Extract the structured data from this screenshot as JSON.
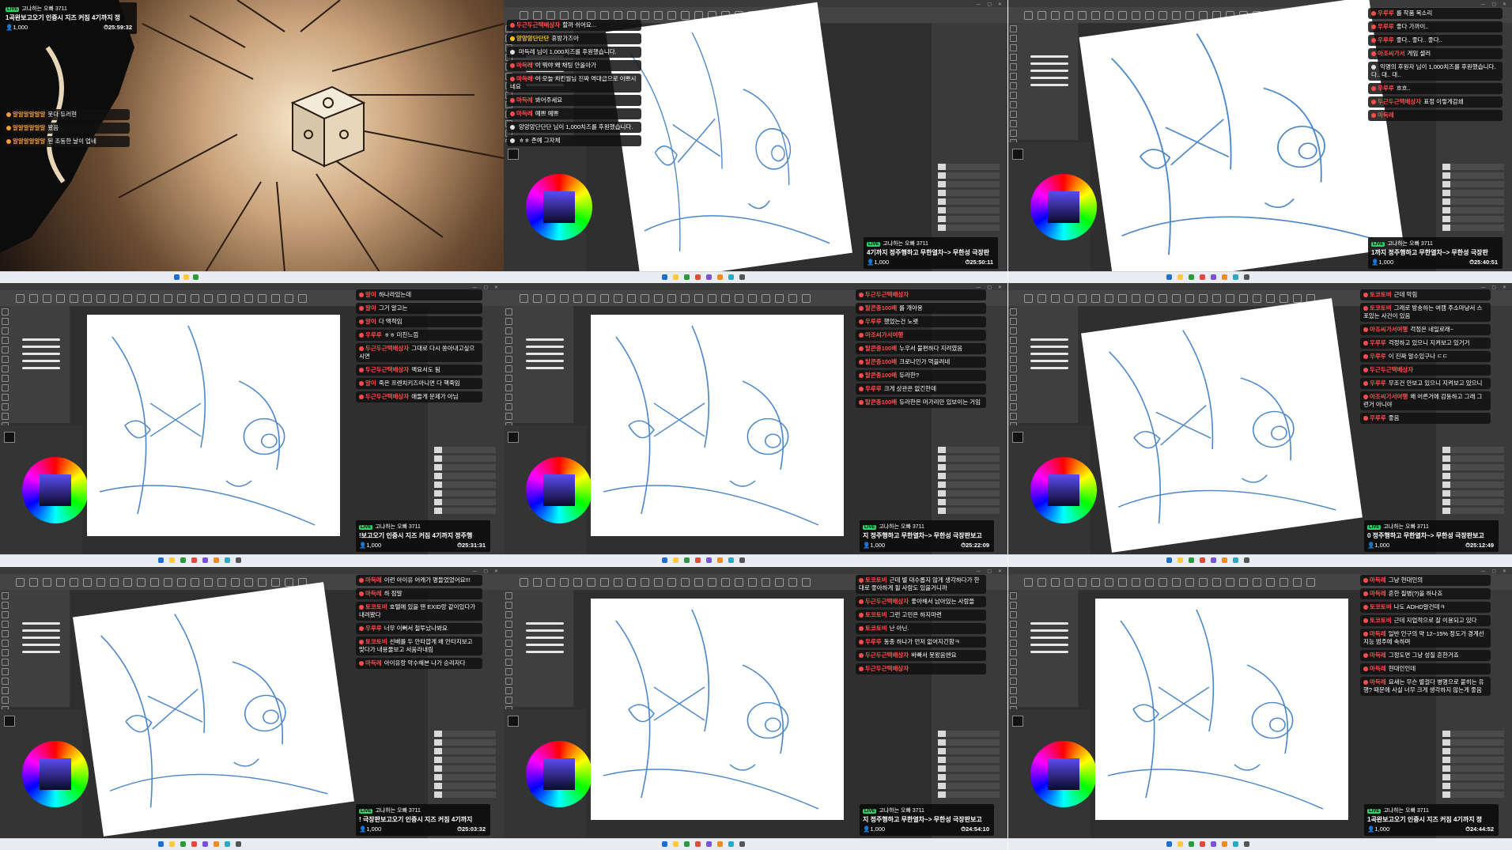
{
  "cells": [
    {
      "id": "cell-1",
      "info": {
        "live": "LIVE",
        "streamer": "고냐하는 오빠 3711",
        "ticker": "1곡완보고오기 인증시 지즈 커짐",
        "suffix": "4기까지 정",
        "viewers": "1,000",
        "timer": "25:59:32"
      },
      "chat": [
        {
          "nick": "알알알알알알",
          "text": "못다 듀러현",
          "color": "#f39a3c"
        },
        {
          "nick": "알알알알알알",
          "text": "왔음",
          "color": "#f39a3c"
        },
        {
          "nick": "알알알알알알",
          "text": "된 조동한 날이 업네",
          "color": "#f39a3c"
        }
      ]
    },
    {
      "id": "cell-2",
      "info": {
        "live": "LIVE",
        "streamer": "고냐하는 오빠 3711",
        "ticker": "4기까지 정주행하고 무한열차~> 무한성 극장판",
        "suffix": "",
        "viewers": "1,000",
        "timer": "25:50:11"
      },
      "chat": [
        {
          "nick": "두근두근택배상자",
          "text": "할까 쉬어요...",
          "color": "#ff4d4d"
        },
        {
          "nick": "앙앙앙단단단",
          "text": "휴방가즈아",
          "color": "#f0c419"
        },
        {
          "nick": "",
          "text": "마득레 님이 1,000치즈를 후원했습니다.",
          "color": "#ffffff"
        },
        {
          "nick": "마득레",
          "text": "이 뭐야 왜 채팅 안올아가",
          "color": "#ff4d4d"
        },
        {
          "nick": "마득레",
          "text": "이 오늘 치킨월님 진짜 역대급으로 이쁘시네요",
          "color": "#ff4d4d"
        },
        {
          "nick": "마득레",
          "text": "봐어주세요",
          "color": "#ff4d4d"
        },
        {
          "nick": "마득레",
          "text": "예쁘 예쁘",
          "color": "#ff4d4d"
        },
        {
          "nick": "",
          "text": "앙앙앙단단단 님이 1,000치즈를 후원했습니다.",
          "color": "#ffffff"
        },
        {
          "nick": "",
          "text": "ㅎㅎ 존예 그자체",
          "color": "#ffffff"
        }
      ]
    },
    {
      "id": "cell-3",
      "info": {
        "live": "LIVE",
        "streamer": "고냐하는 오빠 3711",
        "ticker": "1까지 정주행하고 무한열차~> 무한성 극장판",
        "suffix": "",
        "viewers": "1,000",
        "timer": "25:40:51"
      },
      "chat": [
        {
          "nick": "우루루",
          "text": "를 작품 목소리",
          "color": "#ff4d4d"
        },
        {
          "nick": "우루루",
          "text": "좋다 가까이..",
          "color": "#ff4d4d"
        },
        {
          "nick": "우루루",
          "text": "좋다.. 좋다.. 좋다..",
          "color": "#ff4d4d"
        },
        {
          "nick": "아조씨가서",
          "text": "게임 셀러",
          "color": "#ff4d4d"
        },
        {
          "nick": "",
          "text": "익명의 후원자 님이 1,000치즈를 후원했습니다. 다.. 대.. 대..",
          "color": "#ffffff"
        },
        {
          "nick": "우루루",
          "text": "흐흐..",
          "color": "#ff4d4d"
        },
        {
          "nick": "두근두근택배상자",
          "text": "표정 이렇게감쇄",
          "color": "#ff4d4d"
        },
        {
          "nick": "마득레",
          "text": "",
          "color": "#ff4d4d"
        }
      ]
    },
    {
      "id": "cell-4",
      "info": {
        "live": "LIVE",
        "streamer": "고냐하는 오빠 3711",
        "ticker": "!보고오기 인증시 지즈 커짐",
        "suffix": "4기까지 정주행",
        "viewers": "1,000",
        "timer": "25:31:31"
      },
      "chat": [
        {
          "nick": "알이",
          "text": "하나라있는데",
          "color": "#ff4d4d"
        },
        {
          "nick": "알이",
          "text": "그거 알고는",
          "color": "#ff4d4d"
        },
        {
          "nick": "알이",
          "text": "다 액적임",
          "color": "#ff4d4d"
        },
        {
          "nick": "우루루",
          "text": "ㅎㅎ 미친느낌",
          "color": "#ff4d4d"
        },
        {
          "nick": "두근두근택배상자",
          "text": "그대로 다시 쏭아내고싶으시면",
          "color": "#ff4d4d"
        },
        {
          "nick": "두근두근택배상자",
          "text": "맥요서도 됨",
          "color": "#ff4d4d"
        },
        {
          "nick": "알이",
          "text": "죽은 프렌치키즈아니면 다 핵죽임",
          "color": "#ff4d4d"
        },
        {
          "nick": "두근두근택배상자",
          "text": "애들게 문제가 아님",
          "color": "#ff4d4d"
        }
      ]
    },
    {
      "id": "cell-5",
      "info": {
        "live": "LIVE",
        "streamer": "고냐하는 오빠 3711",
        "ticker": "지 정주행하고 무한열차~> 무한성 극장판보고",
        "suffix": "",
        "viewers": "1,000",
        "timer": "25:22:09"
      },
      "chat": [
        {
          "nick": "두근두근택배상자",
          "text": "",
          "color": "#ff4d4d"
        },
        {
          "nick": "탈콘종100배",
          "text": "를 개아용",
          "color": "#ff4d4d"
        },
        {
          "nick": "우루루",
          "text": "했었는건 노랫",
          "color": "#ff4d4d"
        },
        {
          "nick": "아조씨가서여행",
          "text": "",
          "color": "#ff4d4d"
        },
        {
          "nick": "탈콘종100배",
          "text": "누우서 불편하다 지려였음",
          "color": "#ff4d4d"
        },
        {
          "nick": "탈콘종100배",
          "text": "크로나인가 먹을려네",
          "color": "#ff4d4d"
        },
        {
          "nick": "탈콘종100배",
          "text": "듀라한?",
          "color": "#ff4d4d"
        },
        {
          "nick": "우루루",
          "text": "크게 상관은 없긴한데",
          "color": "#ff4d4d"
        },
        {
          "nick": "탈콘종100배",
          "text": "듀라한은 머가리만 있보이는 거임",
          "color": "#ff4d4d"
        }
      ]
    },
    {
      "id": "cell-6",
      "info": {
        "live": "LIVE",
        "streamer": "고냐하는 오빠 3711",
        "ticker": "0 정주행하고 무한열차~> 무한성 극장판보고",
        "suffix": "",
        "viewers": "1,000",
        "timer": "25:12:49"
      },
      "chat": [
        {
          "nick": "토코토비",
          "text": "근데 막힘",
          "color": "#ff4d4d"
        },
        {
          "nick": "토코토비",
          "text": "그래로 방송하는 여캠 주소마냥서 스포있는 사건이 있음",
          "color": "#ff4d4d"
        },
        {
          "nick": "아조씨가서여행",
          "text": "걱정은 네일로래~",
          "color": "#ff4d4d"
        },
        {
          "nick": "우루루",
          "text": "걱정하고 있으니 지켜보고 있거거",
          "color": "#ff4d4d"
        },
        {
          "nick": "우루루",
          "text": "이 진짜 알수있구나 ㄷㄷ",
          "color": "#ff4d4d"
        },
        {
          "nick": "두근두근택배상자",
          "text": "",
          "color": "#ff4d4d"
        },
        {
          "nick": "우루루",
          "text": "무조건 안보고 있으니 지켜보고 있으니",
          "color": "#ff4d4d"
        },
        {
          "nick": "아조씨가서여행",
          "text": "왜 어른거에 감동하고 그래 그런거 아니야",
          "color": "#ff4d4d"
        },
        {
          "nick": "우루루",
          "text": "좋음",
          "color": "#ff4d4d"
        }
      ]
    },
    {
      "id": "cell-7",
      "info": {
        "live": "LIVE",
        "streamer": "고냐하는 오빠 3711",
        "ticker": "! 극장판보고오기 인증시 지즈 커짐",
        "suffix": "4기까지",
        "viewers": "1,000",
        "timer": "25:03:32"
      },
      "chat": [
        {
          "nick": "마득레",
          "text": "이런 아이유 어캐가 명들었었어요!!!",
          "color": "#ff4d4d"
        },
        {
          "nick": "마득레",
          "text": "하 점말",
          "color": "#ff4d4d"
        },
        {
          "nick": "토코토비",
          "text": "호텔에 있을 땐 EXID랑 같이있다가 내려봤다",
          "color": "#ff4d4d"
        },
        {
          "nick": "우루루",
          "text": "너무 이뻐서 철투났나봐요",
          "color": "#ff4d4d"
        },
        {
          "nick": "토코토비",
          "text": "선배를 두 안타깝게 왜 안타지보고 맞다가 내용물보고 서움라내림",
          "color": "#ff4d4d"
        },
        {
          "nick": "마득레",
          "text": "아이유랑 악수해본 나가 승리자다",
          "color": "#ff4d4d"
        }
      ]
    },
    {
      "id": "cell-8",
      "info": {
        "live": "LIVE",
        "streamer": "고냐하는 오빠 3711",
        "ticker": "지 정주행하고 무한열차~> 무한성 극장판보고",
        "suffix": "",
        "viewers": "1,000",
        "timer": "24:54:10"
      },
      "chat": [
        {
          "nick": "토코토비",
          "text": "근데 별 대수롭지 않게 생각하다가 한대로 좋아하게 될 사람도 있을거니까",
          "color": "#ff4d4d"
        },
        {
          "nick": "두근두근택배상자",
          "text": "좋아해서 남아있는 사람들",
          "color": "#ff4d4d"
        },
        {
          "nick": "토코토비",
          "text": "그런 고민은 하지마련",
          "color": "#ff4d4d"
        },
        {
          "nick": "토코토비",
          "text": "난 아닌.",
          "color": "#ff4d4d"
        },
        {
          "nick": "우루루",
          "text": "동종 하나가 먼저 없어지긴함ㅋ",
          "color": "#ff4d4d"
        },
        {
          "nick": "두근두근택배상자",
          "text": "바빠서 못왔음엔요",
          "color": "#ff4d4d"
        },
        {
          "nick": "두근두근택배상자",
          "text": "",
          "color": "#ff4d4d"
        }
      ]
    },
    {
      "id": "cell-9",
      "info": {
        "live": "LIVE",
        "streamer": "고냐하는 오빠 3711",
        "ticker": "1곡완보고오기 인증시 지즈 커짐",
        "suffix": "4기까지 정",
        "viewers": "1,000",
        "timer": "24:44:52"
      },
      "chat": [
        {
          "nick": "마득레",
          "text": "그냥 현대인의",
          "color": "#ff4d4d"
        },
        {
          "nick": "마득레",
          "text": "흔한 질병(?)을 하나죠",
          "color": "#ff4d4d"
        },
        {
          "nick": "토코토비",
          "text": "나도 ADHD알건데ㅋ",
          "color": "#ff4d4d"
        },
        {
          "nick": "토코토비",
          "text": "근데 지업적으로 잘 이용되고 있다",
          "color": "#ff4d4d"
        },
        {
          "nick": "마득레",
          "text": "일반 인구의 약 12~15% 정도가 경계선 지능 범주에 속하며",
          "color": "#ff4d4d"
        },
        {
          "nick": "마득레",
          "text": "그정도면 그냥 성질 흔한거죠",
          "color": "#ff4d4d"
        },
        {
          "nick": "마득레",
          "text": "현대인인데",
          "color": "#ff4d4d"
        },
        {
          "nick": "마득레",
          "text": "요새는 무슨 별걸다 병명으로 붙히는 유행? 때문에 사실 너무 크게 생각하지 않는게 좋음",
          "color": "#ff4d4d"
        }
      ]
    }
  ],
  "colors": {
    "live_badge": "#2fd36a",
    "chat_bg": "#121212",
    "canvas": "#ffffff",
    "panel": "#3a3a3a",
    "sketch_line": "#4a86c8"
  }
}
